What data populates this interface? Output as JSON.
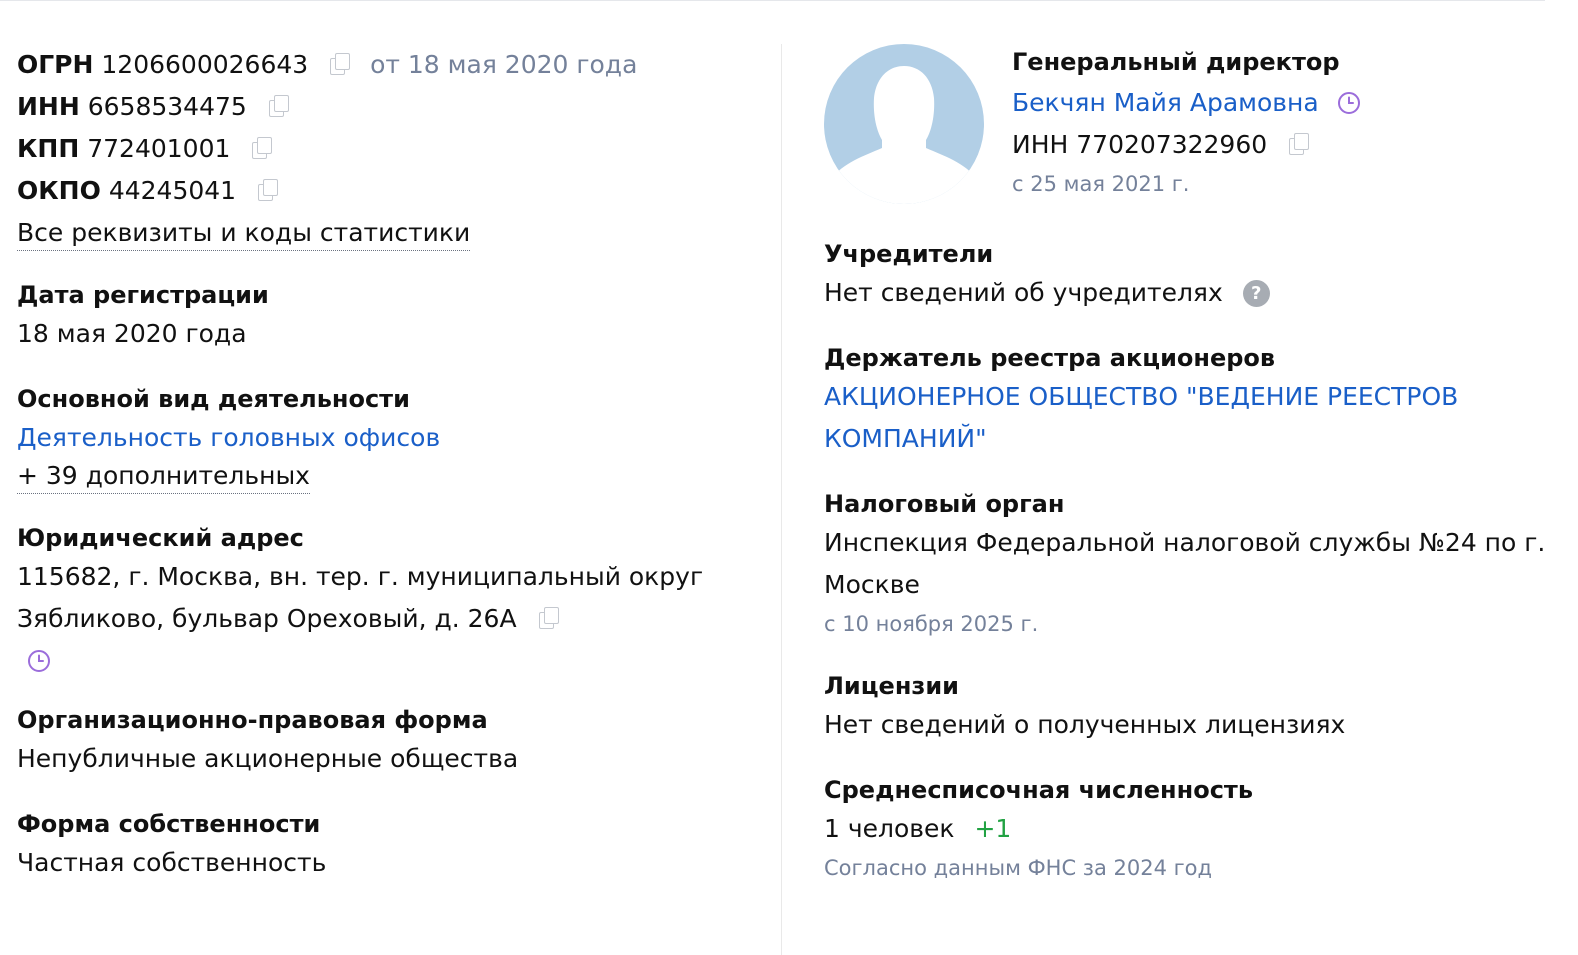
{
  "codes": {
    "ogrn": {
      "label": "ОГРН",
      "value": "1206600026643",
      "date": "от 18 мая 2020 года"
    },
    "inn": {
      "label": "ИНН",
      "value": "6658534475"
    },
    "kpp": {
      "label": "КПП",
      "value": "772401001"
    },
    "okpo": {
      "label": "ОКПО",
      "value": "44245041"
    },
    "all_link": "Все реквизиты и коды статистики"
  },
  "registration": {
    "heading": "Дата регистрации",
    "value": "18 мая 2020 года"
  },
  "activity": {
    "heading": "Основной вид деятельности",
    "main": "Деятельность головных офисов",
    "more": "+ 39 дополнительных"
  },
  "address": {
    "heading": "Юридический адрес",
    "line1": "115682, г. Москва, вн. тер. г. муниципальный округ",
    "line2": "Зябликово, бульвар Ореховый, д. 26А"
  },
  "legal_form": {
    "heading": "Организационно-правовая форма",
    "value": "Непубличные акционерные общества"
  },
  "ownership": {
    "heading": "Форма собственности",
    "value": "Частная собственность"
  },
  "director": {
    "title": "Генеральный директор",
    "name": "Бекчян Майя Арамовна",
    "inn_label": "ИНН",
    "inn_value": "770207322960",
    "since": "с 25 мая 2021 г."
  },
  "founders": {
    "heading": "Учредители",
    "value": "Нет сведений об учредителях",
    "help": "?"
  },
  "registry": {
    "heading": "Держатель реестра акционеров",
    "line1": "АКЦИОНЕРНОЕ ОБЩЕСТВО \"ВЕДЕНИЕ РЕЕСТРОВ",
    "line2": "КОМПАНИЙ\""
  },
  "tax": {
    "heading": "Налоговый орган",
    "line1": "Инспекция Федеральной налоговой службы №24 по г.",
    "line2": "Москве",
    "since": "с 10 ноября 2025 г."
  },
  "licenses": {
    "heading": "Лицензии",
    "value": "Нет сведений о полученных лицензиях"
  },
  "employees": {
    "heading": "Среднесписочная численность",
    "value": "1 человек",
    "delta": "+1",
    "note": "Согласно данным ФНС за 2024 год"
  },
  "colors": {
    "link": "#1a5fc8",
    "muted": "#74819a",
    "green": "#22a243",
    "clock": "#9b6ddb",
    "avatar": "#b2cfe6"
  }
}
